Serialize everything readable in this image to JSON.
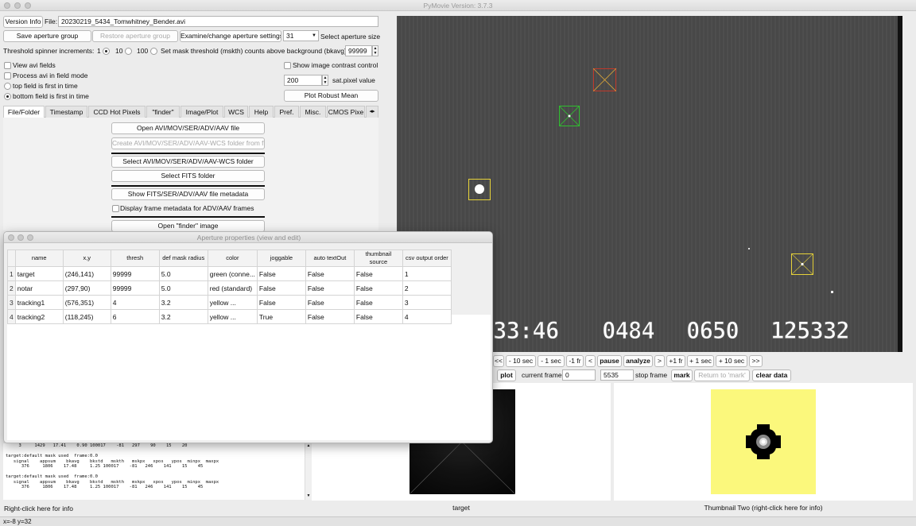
{
  "window": {
    "title": "PyMovie  Version: 3.7.3"
  },
  "top": {
    "version_info": "Version Info",
    "file_label": "File:",
    "file_name": "20230219_5434_Tomwhitney_Bender.avi",
    "save_group": "Save aperture group",
    "restore_group": "Restore aperture group",
    "examine_aperture": "Examine/change aperture settings",
    "aperture_size_value": "31",
    "aperture_size_label": "Select aperture size",
    "spinner_label": "Threshold spinner increments:",
    "spinner_options": [
      "1",
      "10",
      "100"
    ],
    "mask_label": "Set mask threshold (mskth) counts above background (bkavg)",
    "mask_value": "99999",
    "view_avi_fields": "View avi fields",
    "process_field_mode": "Process avi in field mode",
    "top_field_first": "top field is first in time",
    "bottom_field_first": "bottom field is first in time",
    "show_contrast": "Show image contrast control",
    "sat_value": "200",
    "sat_label": "sat.pixel value",
    "plot_robust_mean": "Plot Robust Mean"
  },
  "tabs": [
    "File/Folder",
    "Timestamp",
    "CCD Hot Pixels",
    "\"finder\"",
    "Image/Plot",
    "WCS",
    "Help",
    "Pref.",
    "Misc.",
    "CMOS Pixe"
  ],
  "file_folder": {
    "open_file": "Open AVI/MOV/SER/ADV/AAV file",
    "create_wcs": "Create AVI/MOV/SER/ADV/AAV-WCS folder from file",
    "select_wcs": "Select AVI/MOV/SER/ADV/AAV-WCS folder",
    "select_fits": "Select FITS folder",
    "show_metadata": "Show FITS/SER/ADV/AAV file metadata",
    "display_metadata": "Display frame metadata for ADV/AAV frames",
    "open_finder": "Open \"finder\" image"
  },
  "video": {
    "overlay_parts": [
      "33:46",
      "0484",
      "0650",
      "125332"
    ]
  },
  "playback": {
    "buttons": [
      "<<",
      "- 10 sec",
      "- 1 sec",
      "-1 fr",
      "<",
      "pause",
      "analyze",
      ">",
      "+1 fr",
      "+ 1 sec",
      "+ 10 sec",
      ">>"
    ],
    "plot": "plot",
    "current_frame_label": "current frame",
    "current_frame": "0",
    "stop_frame": "5535",
    "stop_frame_label": "stop frame",
    "mark": "mark",
    "return_mark": "Return to 'mark'",
    "clear_data": "clear data"
  },
  "thumbs": {
    "one_label": "target",
    "two_label": "Thumbnail Two (right-click here for info)"
  },
  "status": {
    "right_click_info": "Right-click here for info",
    "coords": "x=-8 y=32"
  },
  "dialog": {
    "title": "Aperture properties (view and edit)",
    "columns": [
      "name",
      "x,y",
      "thresh",
      "def mask radius",
      "color",
      "joggable",
      "auto textOut",
      "thumbnail source",
      "csv output order"
    ],
    "rows": [
      [
        "target",
        "(246,141)",
        "99999",
        "5.0",
        "green (conne...",
        "False",
        "False",
        "False",
        "1"
      ],
      [
        "notar",
        "(297,90)",
        "99999",
        "5.0",
        "red (standard)",
        "False",
        "False",
        "False",
        "2"
      ],
      [
        "tracking1",
        "(576,351)",
        "4",
        "3.2",
        "yellow ...",
        "False",
        "False",
        "False",
        "3"
      ],
      [
        "tracking2",
        "(118,245)",
        "6",
        "3.2",
        "yellow ...",
        "True",
        "False",
        "False",
        "4"
      ]
    ]
  },
  "log_lines": [
    "     3     1429   17.41    0.90 100017    -81   297    90    15    20",
    "",
    "target:default mask used  frame:0.0",
    "   signal    appsum    bkavg    bkstd   mskth   mskpx   xpos   ypos  minpx  maxpx",
    "      376     1806    17.48     1.25 100017    -81   246    141    15    45",
    "",
    "target:default mask used  frame:0.0",
    "   signal    appsum    bkavg    bkstd   mskth   mskpx   xpos   ypos  minpx  maxpx",
    "      376     1806    17.48     1.25 100017    -81   246    141    15    45"
  ],
  "colors": {
    "green_box": "#2fbf2f",
    "red_box": "#c0392b",
    "yellow_box": "#e6d23a",
    "thumb_yellow": "#fbf87c"
  }
}
